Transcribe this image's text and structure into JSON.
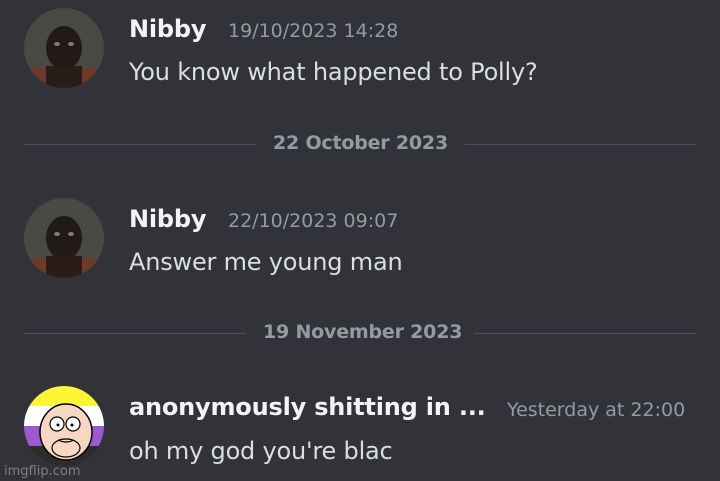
{
  "messages": [
    {
      "author": "Nibby",
      "timestamp": "19/10/2023 14:28",
      "content": "You know what happened to Polly?"
    },
    {
      "author": "Nibby",
      "timestamp": "22/10/2023 09:07",
      "content": "Answer me young man"
    },
    {
      "author": "anonymously shitting in ...",
      "timestamp": "Yesterday at 22:00",
      "content": "oh my god you're blac"
    }
  ],
  "dividers": [
    "22 October 2023",
    "19 November 2023"
  ],
  "watermark": "imgflip.com",
  "colors": {
    "background": "#313338",
    "author_text": "#f2f3f5",
    "message_text": "#dbdee1",
    "muted_text": "#949ba4",
    "divider_line": "#4e5058"
  }
}
